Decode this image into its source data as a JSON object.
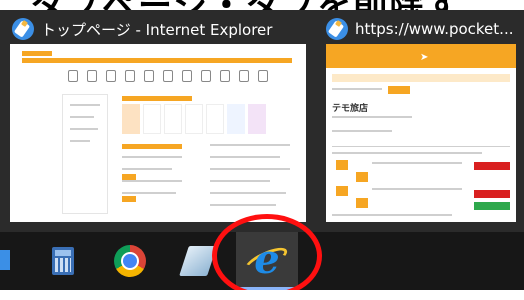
{
  "top_text": "タブページ・タブを削除す",
  "windows": [
    {
      "title": "トップページ - Internet Explorer"
    },
    {
      "title": "https://www.pocket..."
    }
  ],
  "pocket_page": {
    "section_label": "テモ旅店"
  },
  "taskbar": {
    "items": [
      "calculator-icon",
      "chrome-icon",
      "notepad-icon",
      "internet-explorer-icon"
    ],
    "active": "internet-explorer-icon"
  },
  "colors": {
    "panel": "#2b2b2b",
    "taskbar": "#171717",
    "accent_orange": "#f6a623",
    "annotation_red": "#ff1010",
    "ie_blue": "#1e8be6"
  }
}
